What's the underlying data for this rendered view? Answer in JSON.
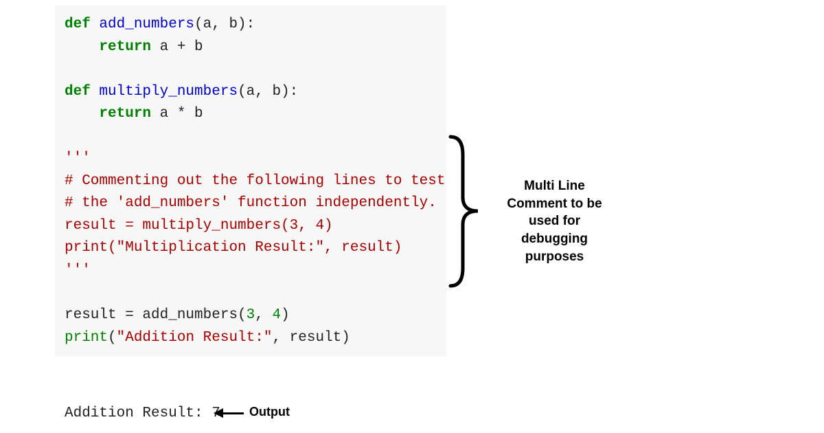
{
  "code": {
    "line1_def": "def",
    "line1_fn": " add_numbers",
    "line1_rest": "(a, b):",
    "line2_indent": "    ",
    "line2_return": "return",
    "line2_expr": " a + b",
    "line3": "",
    "line4_def": "def",
    "line4_fn": " multiply_numbers",
    "line4_rest": "(a, b):",
    "line5_indent": "    ",
    "line5_return": "return",
    "line5_expr": " a * b",
    "line6": "",
    "line7_triple": "'''",
    "line8": "# Commenting out the following lines to test",
    "line9": "# the 'add_numbers' function independently.",
    "line10": "result = multiply_numbers(3, 4)",
    "line11": "print(\"Multiplication Result:\", result)",
    "line12_triple": "'''",
    "line13": "",
    "line14_a": "result = add_numbers(",
    "line14_b": "3",
    "line14_c": ", ",
    "line14_d": "4",
    "line14_e": ")",
    "line15_a": "print",
    "line15_b": "(",
    "line15_c": "\"Addition Result:\"",
    "line15_d": ", result)"
  },
  "output": "Addition Result: 7",
  "output_label": "Output",
  "annotation": "Multi Line Comment to be used for debugging purposes"
}
